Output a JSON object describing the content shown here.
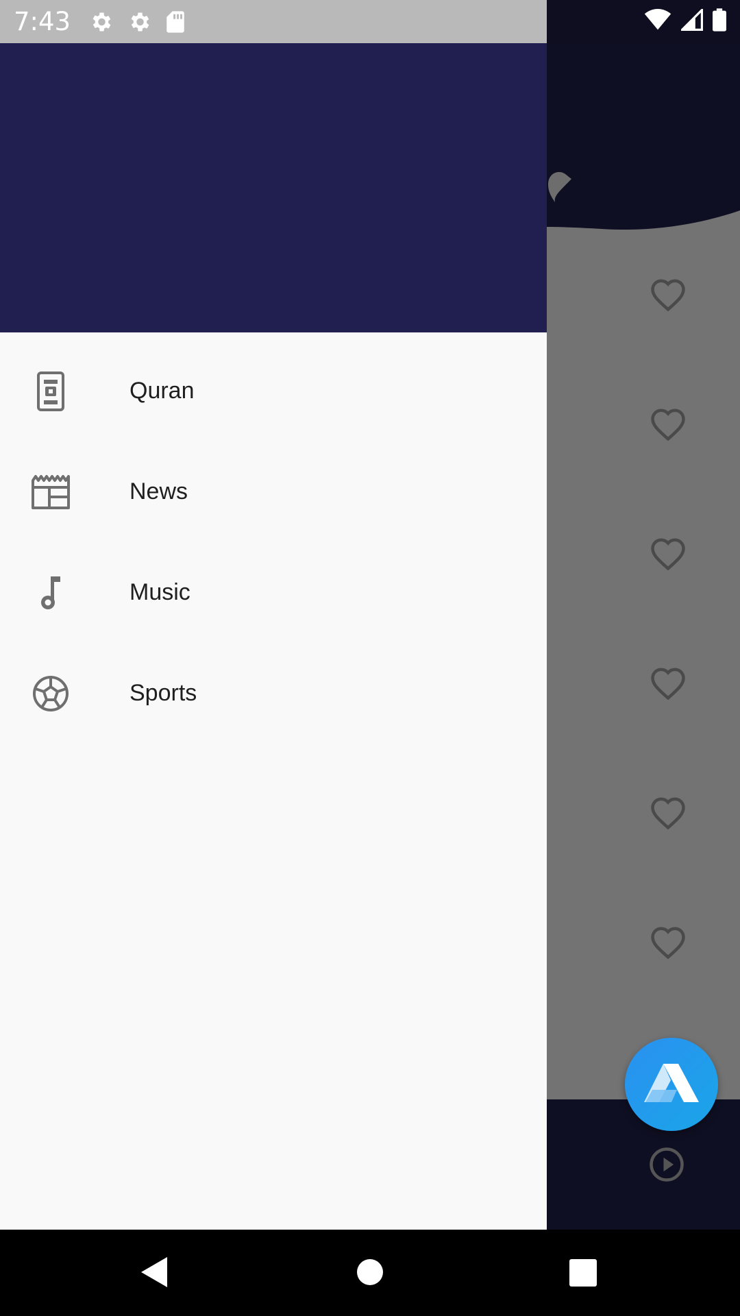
{
  "status_bar": {
    "time": "7:43",
    "left_icons": [
      "gear-icon",
      "gear-icon",
      "sd-card-icon"
    ],
    "right_icons": [
      "wifi-icon",
      "signal-icon",
      "battery-icon"
    ]
  },
  "drawer": {
    "header_color": "#201f50",
    "items": [
      {
        "label": "Quran",
        "icon": "quran-book-icon"
      },
      {
        "label": "News",
        "icon": "newspaper-icon"
      },
      {
        "label": "Music",
        "icon": "music-note-icon"
      },
      {
        "label": "Sports",
        "icon": "soccer-ball-icon"
      }
    ]
  },
  "background_app": {
    "favorite_icons": 6,
    "play_icon": "play-circle-icon",
    "fab_icon": "app-logo-icon"
  },
  "nav_bar": {
    "buttons": [
      "back-icon",
      "home-icon",
      "recents-icon"
    ]
  },
  "colors": {
    "drawer_header": "#201f50",
    "drawer_bg": "#f9f9f9",
    "fab": "#1e9ae8",
    "dark_bar": "#0e0e20"
  }
}
